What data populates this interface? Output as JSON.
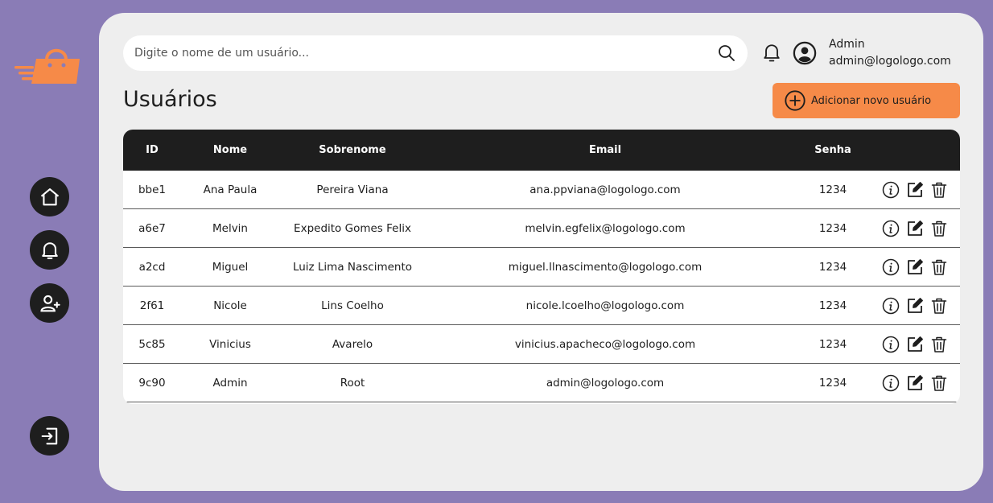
{
  "sidebar": {
    "logo_icon": "shopping-bag-speed-logo",
    "logo_color": "#f68a48",
    "items": [
      {
        "name": "home",
        "icon": "home-icon"
      },
      {
        "name": "notifications",
        "icon": "bell-icon"
      },
      {
        "name": "add-user",
        "icon": "add-user-icon"
      },
      {
        "name": "logout",
        "icon": "logout-icon"
      }
    ]
  },
  "header": {
    "search_placeholder": "Digite o nome de um usuário...",
    "search_value": "",
    "user": {
      "name": "Admin",
      "email": "admin@logologo.com"
    }
  },
  "page": {
    "title": "Usuários",
    "add_button_label": "Adicionar novo usuário"
  },
  "table": {
    "columns": [
      "ID",
      "Nome",
      "Sobrenome",
      "Email",
      "Senha"
    ],
    "rows": [
      {
        "id": "bbe1",
        "nome": "Ana Paula",
        "sobrenome": "Pereira Viana",
        "email": "ana.ppviana@logologo.com",
        "senha": "1234"
      },
      {
        "id": "a6e7",
        "nome": "Melvin",
        "sobrenome": "Expedito Gomes Felix",
        "email": "melvin.egfelix@logologo.com",
        "senha": "1234"
      },
      {
        "id": "a2cd",
        "nome": "Miguel",
        "sobrenome": "Luiz Lima Nascimento",
        "email": "miguel.llnascimento@logologo.com",
        "senha": "1234"
      },
      {
        "id": "2f61",
        "nome": "Nicole",
        "sobrenome": "Lins Coelho",
        "email": "nicole.lcoelho@logologo.com",
        "senha": "1234"
      },
      {
        "id": "5c85",
        "nome": "Vinicius",
        "sobrenome": "Avarelo",
        "email": "vinicius.apacheco@logologo.com",
        "senha": "1234"
      },
      {
        "id": "9c90",
        "nome": "Admin",
        "sobrenome": "Root",
        "email": "admin@logologo.com",
        "senha": "1234"
      }
    ],
    "row_actions": [
      "info-icon",
      "edit-icon",
      "trash-icon"
    ]
  },
  "colors": {
    "background": "#8a7cb6",
    "panel": "#eeeeee",
    "accent": "#f68a48",
    "dark": "#1e1e1e"
  }
}
